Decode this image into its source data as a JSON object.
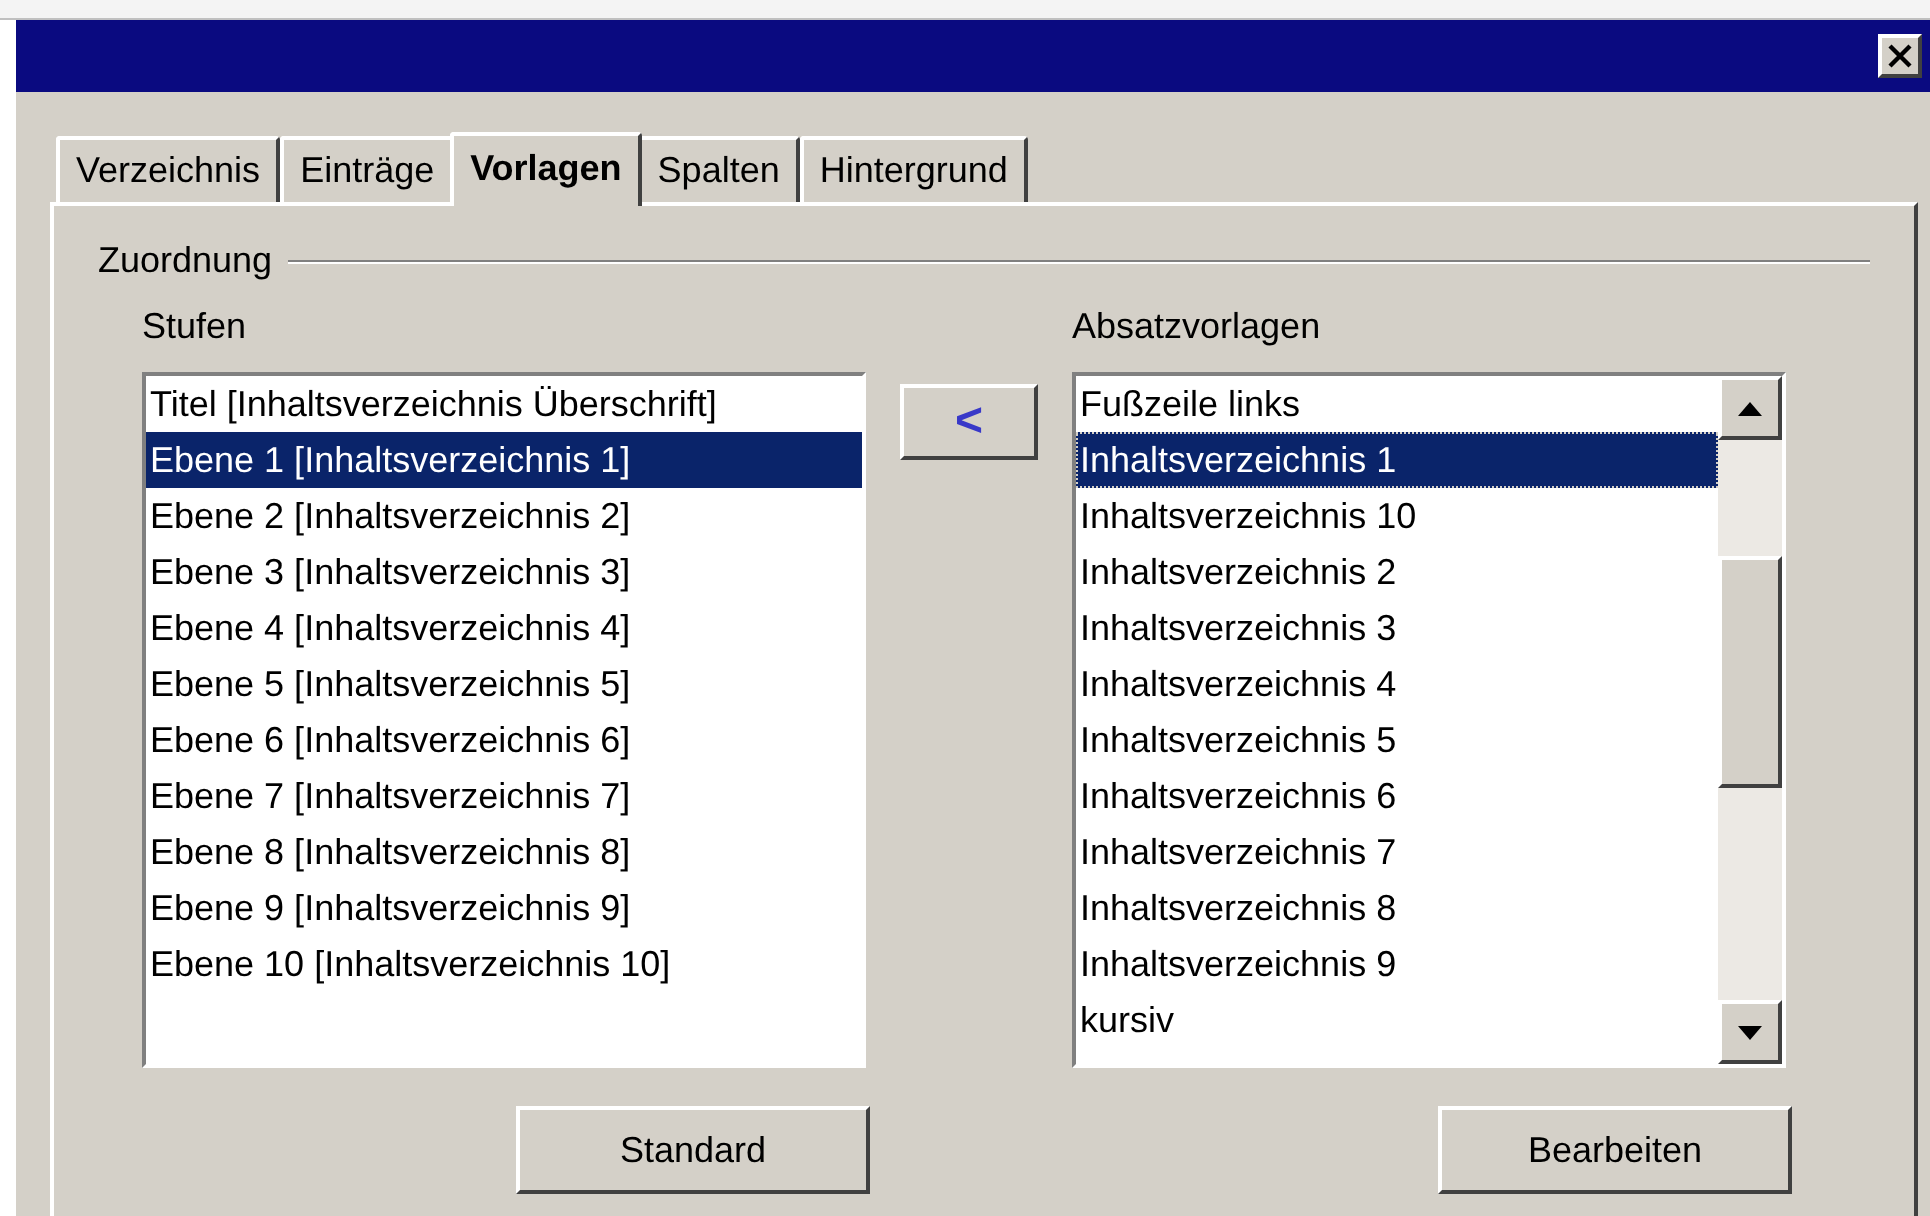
{
  "tabs": [
    {
      "label": "Verzeichnis",
      "selected": false
    },
    {
      "label": "Einträge",
      "selected": false
    },
    {
      "label": "Vorlagen",
      "selected": true
    },
    {
      "label": "Spalten",
      "selected": false
    },
    {
      "label": "Hintergrund",
      "selected": false
    }
  ],
  "group_title": "Zuordnung",
  "levels": {
    "label": "Stufen",
    "items": [
      {
        "text": "Titel [Inhaltsverzeichnis Überschrift]",
        "selected": false
      },
      {
        "text": "Ebene 1 [Inhaltsverzeichnis 1]",
        "selected": true
      },
      {
        "text": "Ebene 2 [Inhaltsverzeichnis 2]",
        "selected": false
      },
      {
        "text": "Ebene 3 [Inhaltsverzeichnis 3]",
        "selected": false
      },
      {
        "text": "Ebene 4 [Inhaltsverzeichnis 4]",
        "selected": false
      },
      {
        "text": "Ebene 5 [Inhaltsverzeichnis 5]",
        "selected": false
      },
      {
        "text": "Ebene 6 [Inhaltsverzeichnis 6]",
        "selected": false
      },
      {
        "text": "Ebene 7 [Inhaltsverzeichnis 7]",
        "selected": false
      },
      {
        "text": "Ebene 8 [Inhaltsverzeichnis 8]",
        "selected": false
      },
      {
        "text": "Ebene 9 [Inhaltsverzeichnis 9]",
        "selected": false
      },
      {
        "text": "Ebene 10 [Inhaltsverzeichnis 10]",
        "selected": false
      }
    ]
  },
  "assign_button": "<",
  "styles": {
    "label": "Absatzvorlagen",
    "items": [
      {
        "text": "Fußzeile links",
        "selected": false
      },
      {
        "text": "Inhaltsverzeichnis 1",
        "selected": true
      },
      {
        "text": "Inhaltsverzeichnis 10",
        "selected": false
      },
      {
        "text": "Inhaltsverzeichnis 2",
        "selected": false
      },
      {
        "text": "Inhaltsverzeichnis 3",
        "selected": false
      },
      {
        "text": "Inhaltsverzeichnis 4",
        "selected": false
      },
      {
        "text": "Inhaltsverzeichnis 5",
        "selected": false
      },
      {
        "text": "Inhaltsverzeichnis 6",
        "selected": false
      },
      {
        "text": "Inhaltsverzeichnis 7",
        "selected": false
      },
      {
        "text": "Inhaltsverzeichnis 8",
        "selected": false
      },
      {
        "text": "Inhaltsverzeichnis 9",
        "selected": false
      },
      {
        "text": "kursiv",
        "selected": false
      }
    ]
  },
  "buttons": [
    "Standard",
    "Bearbeiten"
  ]
}
